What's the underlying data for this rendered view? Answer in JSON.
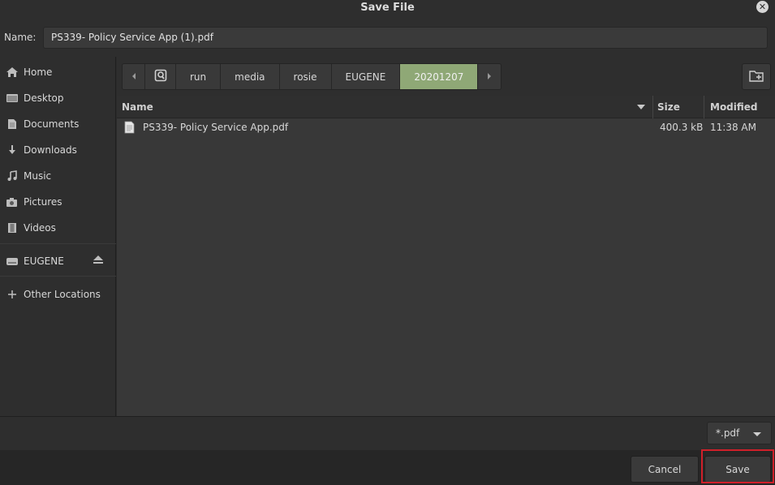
{
  "window": {
    "title": "Save File"
  },
  "name_field": {
    "label": "Name:",
    "value": "PS339- Policy Service App (1).pdf"
  },
  "sidebar": {
    "items": [
      {
        "label": "Home",
        "icon": "home-icon"
      },
      {
        "label": "Desktop",
        "icon": "desktop-icon"
      },
      {
        "label": "Documents",
        "icon": "document-icon"
      },
      {
        "label": "Downloads",
        "icon": "download-icon"
      },
      {
        "label": "Music",
        "icon": "music-icon"
      },
      {
        "label": "Pictures",
        "icon": "camera-icon"
      },
      {
        "label": "Videos",
        "icon": "film-icon"
      }
    ],
    "device": {
      "label": "EUGENE",
      "icon": "drive-icon"
    },
    "other": {
      "label": "Other Locations",
      "icon": "plus-icon"
    }
  },
  "pathbar": {
    "segments": [
      "run",
      "media",
      "rosie",
      "EUGENE",
      "20201207"
    ],
    "active": "20201207"
  },
  "columns": {
    "name": "Name",
    "size": "Size",
    "modified": "Modified"
  },
  "files": [
    {
      "name": "PS339- Policy Service App.pdf",
      "size": "400.3 kB",
      "modified": "11:38 AM"
    }
  ],
  "filter": {
    "value": "*.pdf"
  },
  "buttons": {
    "cancel": "Cancel",
    "save": "Save"
  },
  "colors": {
    "accent": "#8fa876",
    "highlight": "#d0202a"
  }
}
